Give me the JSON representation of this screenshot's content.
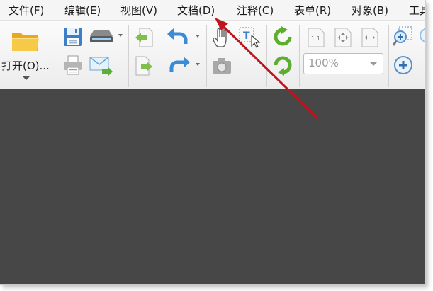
{
  "menu": {
    "items": [
      {
        "label": "文件(F)"
      },
      {
        "label": "编辑(E)"
      },
      {
        "label": "视图(V)"
      },
      {
        "label": "文档(D)"
      },
      {
        "label": "注释(C)"
      },
      {
        "label": "表单(R)"
      },
      {
        "label": "对象(B)"
      },
      {
        "label": "工具"
      }
    ]
  },
  "toolbar": {
    "open_label": "打开(O)...",
    "zoom_value": "100%"
  },
  "colors": {
    "workspace": "#474747",
    "annotation_arrow": "#c0141c"
  }
}
